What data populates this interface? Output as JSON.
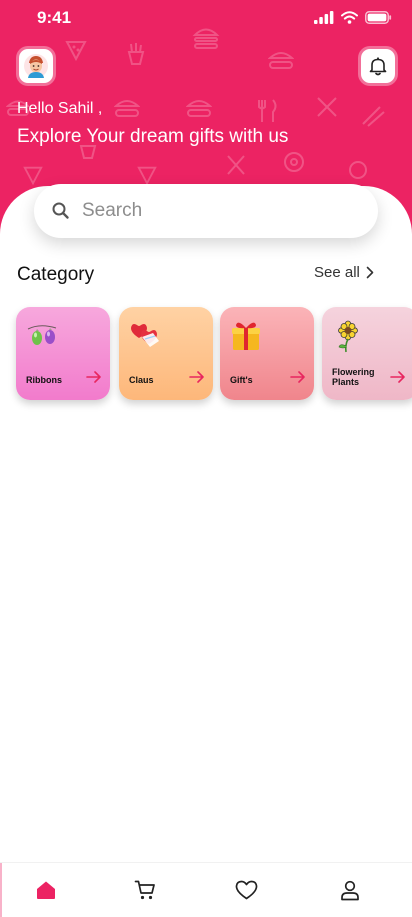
{
  "status_bar": {
    "time": "9:41"
  },
  "header": {
    "greeting": "Hello Sahil ,",
    "tagline": "Explore Your dream gifts with us"
  },
  "search": {
    "placeholder": "Search"
  },
  "category_section": {
    "title": "Category",
    "see_all": "See all",
    "items": [
      {
        "label": "Ribbons",
        "icon": "ribbons-icon",
        "bg": "#f7a3dc"
      },
      {
        "label": "Claus",
        "icon": "hearts-icon",
        "bg": "#fec590"
      },
      {
        "label": "Gift's",
        "icon": "gift-icon",
        "bg": "#f59a9f"
      },
      {
        "label": "Flowering Plants",
        "icon": "flower-icon",
        "bg": "#f3c8d4"
      }
    ]
  },
  "bottom_nav": {
    "items": [
      {
        "name": "home",
        "icon": "home-icon",
        "active": true
      },
      {
        "name": "cart",
        "icon": "cart-icon",
        "active": false
      },
      {
        "name": "favorites",
        "icon": "heart-icon",
        "active": false
      },
      {
        "name": "profile",
        "icon": "profile-icon",
        "active": false
      }
    ]
  },
  "colors": {
    "brand": "#ec2363",
    "arrow": "#e8265f"
  }
}
